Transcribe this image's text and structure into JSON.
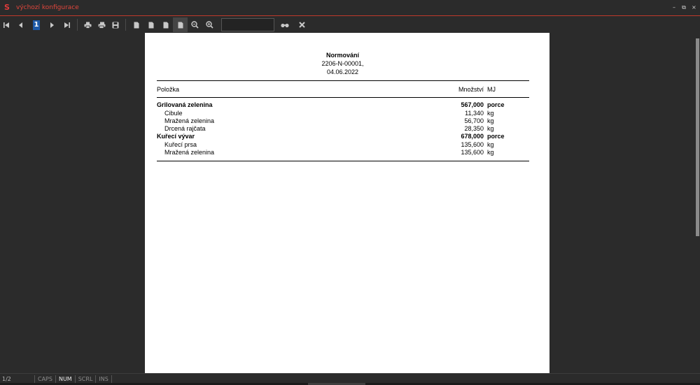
{
  "window": {
    "title": "výchozí konfigurace",
    "controls": {
      "minimize": "–",
      "restore": "⧉",
      "close": "×"
    }
  },
  "toolbar": {
    "current_page": "1",
    "search_value": "",
    "icons": [
      "first-page-icon",
      "prev-page-icon",
      "next-page-icon",
      "last-page-icon",
      "print-icon",
      "print-setup-icon",
      "save-icon",
      "page-view-icon",
      "page-width-icon",
      "two-page-icon",
      "multi-page-icon",
      "zoom-out-icon",
      "zoom-in-icon",
      "find-icon",
      "close-icon"
    ]
  },
  "report": {
    "title": "Normování",
    "number": "2206-N-00001,",
    "date": "04.06.2022",
    "columns": {
      "item": "Položka",
      "quantity": "Množství",
      "unit": "MJ"
    },
    "rows": [
      {
        "name": "Grilovaná zelenina",
        "qty": "567,000",
        "unit": "porce",
        "level": "parent"
      },
      {
        "name": "Cibule",
        "qty": "11,340",
        "unit": "kg",
        "level": "child"
      },
      {
        "name": "Mražená zelenina",
        "qty": "56,700",
        "unit": "kg",
        "level": "child"
      },
      {
        "name": "Drcená rajčata",
        "qty": "28,350",
        "unit": "kg",
        "level": "child"
      },
      {
        "name": "Kuřecí vývar",
        "qty": "678,000",
        "unit": "porce",
        "level": "parent"
      },
      {
        "name": "Kuřecí prsa",
        "qty": "135,600",
        "unit": "kg",
        "level": "child"
      },
      {
        "name": "Mražená zelenina",
        "qty": "135,600",
        "unit": "kg",
        "level": "child"
      }
    ]
  },
  "statusbar": {
    "page_position": "1/2",
    "caps": "CAPS",
    "num": "NUM",
    "scrl": "SCRL",
    "ins": "INS"
  },
  "colors": {
    "accent": "#e0463c",
    "background": "#2b2b2b",
    "page": "#ffffff",
    "selection": "#1e5aa8"
  }
}
